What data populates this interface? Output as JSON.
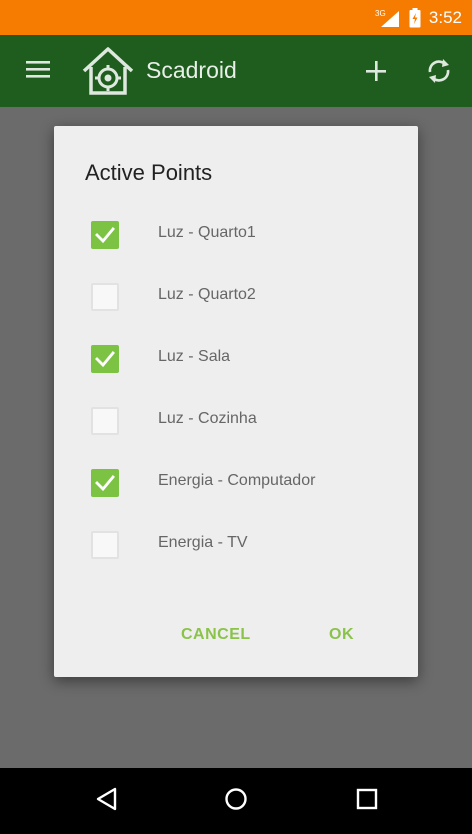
{
  "status_bar": {
    "network_label": "3G",
    "time": "3:52",
    "icons": [
      "signal-icon",
      "battery-icon"
    ],
    "color": "#f57c00"
  },
  "app_bar": {
    "title": "Scadroid",
    "color": "#1f5d1f",
    "icons": [
      "menu-icon",
      "app-logo-icon",
      "add-icon",
      "sync-icon"
    ]
  },
  "dialog": {
    "title": "Active Points",
    "options": [
      {
        "label": "Luz - Quarto1",
        "checked": true
      },
      {
        "label": "Luz - Quarto2",
        "checked": false
      },
      {
        "label": "Luz - Sala",
        "checked": true
      },
      {
        "label": "Luz - Cozinha",
        "checked": false
      },
      {
        "label": "Energia - Computador",
        "checked": true
      },
      {
        "label": "Energia - TV",
        "checked": false
      }
    ],
    "cancel_label": "CANCEL",
    "ok_label": "OK",
    "accent_color": "#7cc243"
  },
  "nav_bar": {
    "icons": [
      "back-icon",
      "home-icon",
      "recents-icon"
    ]
  }
}
